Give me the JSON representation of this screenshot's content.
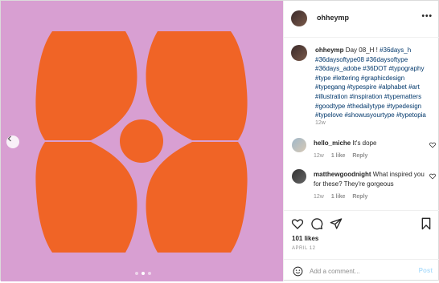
{
  "post": {
    "username": "ohheymp",
    "caption_text": "Day 08_H !",
    "hashtags": "#36days_h #36daysoftype08 #36daysoftype #36days_adobe #36DOT #typography #type #lettering #graphicdesign #typegang #typespire #alphabet #art #illustration #inspiration #typematters #goodtype #thedailytype #typedesign #typelove #showusyourtype #typetopia",
    "caption_age": "12w",
    "likes": "101 likes",
    "date": "APRIL 12"
  },
  "comments": [
    {
      "username": "hello_miche",
      "text": "It's dope",
      "age": "12w",
      "likes": "1 like",
      "reply": "Reply"
    },
    {
      "username": "matthewgoodnight",
      "text": "What inspired you for these? They're gorgeous",
      "age": "12w",
      "likes": "1 like",
      "reply": "Reply"
    }
  ],
  "composer": {
    "placeholder": "Add a comment...",
    "post_label": "Post"
  },
  "more_label": "•••",
  "colors": {
    "background": "#d89fd2",
    "letter": "#f06426"
  }
}
